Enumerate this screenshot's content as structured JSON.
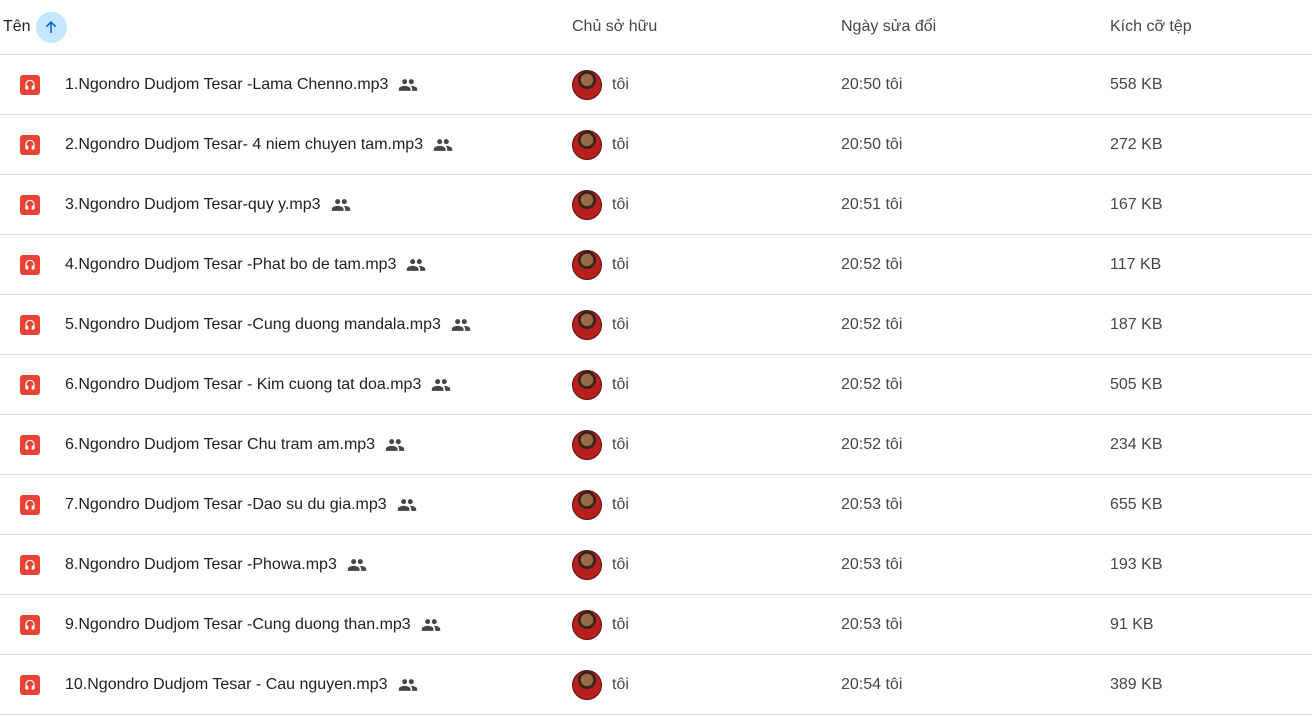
{
  "header": {
    "name_label": "Tên",
    "owner_label": "Chủ sở hữu",
    "modified_label": "Ngày sửa đổi",
    "size_label": "Kích cỡ tệp"
  },
  "colors": {
    "accent": "#c2e7ff",
    "audio_icon": "#ea4335"
  },
  "icons": {
    "sort": "arrow-up-icon",
    "file": "audio-file-icon",
    "shared": "shared-people-icon"
  },
  "files": [
    {
      "name": "1.Ngondro Dudjom Tesar -Lama Chenno.mp3",
      "owner": "tôi",
      "modified": "20:50 tôi",
      "size": "558 KB"
    },
    {
      "name": "2.Ngondro Dudjom Tesar- 4 niem chuyen tam.mp3",
      "owner": "tôi",
      "modified": "20:50 tôi",
      "size": "272 KB"
    },
    {
      "name": "3.Ngondro Dudjom Tesar-quy y.mp3",
      "owner": "tôi",
      "modified": "20:51 tôi",
      "size": "167 KB"
    },
    {
      "name": "4.Ngondro Dudjom Tesar -Phat bo de tam.mp3",
      "owner": "tôi",
      "modified": "20:52 tôi",
      "size": "117 KB"
    },
    {
      "name": "5.Ngondro Dudjom Tesar -Cung duong mandala.mp3",
      "owner": "tôi",
      "modified": "20:52 tôi",
      "size": "187 KB"
    },
    {
      "name": "6.Ngondro Dudjom Tesar - Kim cuong tat doa.mp3",
      "owner": "tôi",
      "modified": "20:52 tôi",
      "size": "505 KB"
    },
    {
      "name": "6.Ngondro Dudjom Tesar Chu tram am.mp3",
      "owner": "tôi",
      "modified": "20:52 tôi",
      "size": "234 KB"
    },
    {
      "name": "7.Ngondro Dudjom Tesar -Dao su du gia.mp3",
      "owner": "tôi",
      "modified": "20:53 tôi",
      "size": "655 KB"
    },
    {
      "name": "8.Ngondro Dudjom Tesar -Phowa.mp3",
      "owner": "tôi",
      "modified": "20:53 tôi",
      "size": "193 KB"
    },
    {
      "name": "9.Ngondro Dudjom Tesar -Cung duong than.mp3",
      "owner": "tôi",
      "modified": "20:53 tôi",
      "size": "91 KB"
    },
    {
      "name": "10.Ngondro Dudjom Tesar - Cau nguyen.mp3",
      "owner": "tôi",
      "modified": "20:54 tôi",
      "size": "389 KB"
    }
  ]
}
